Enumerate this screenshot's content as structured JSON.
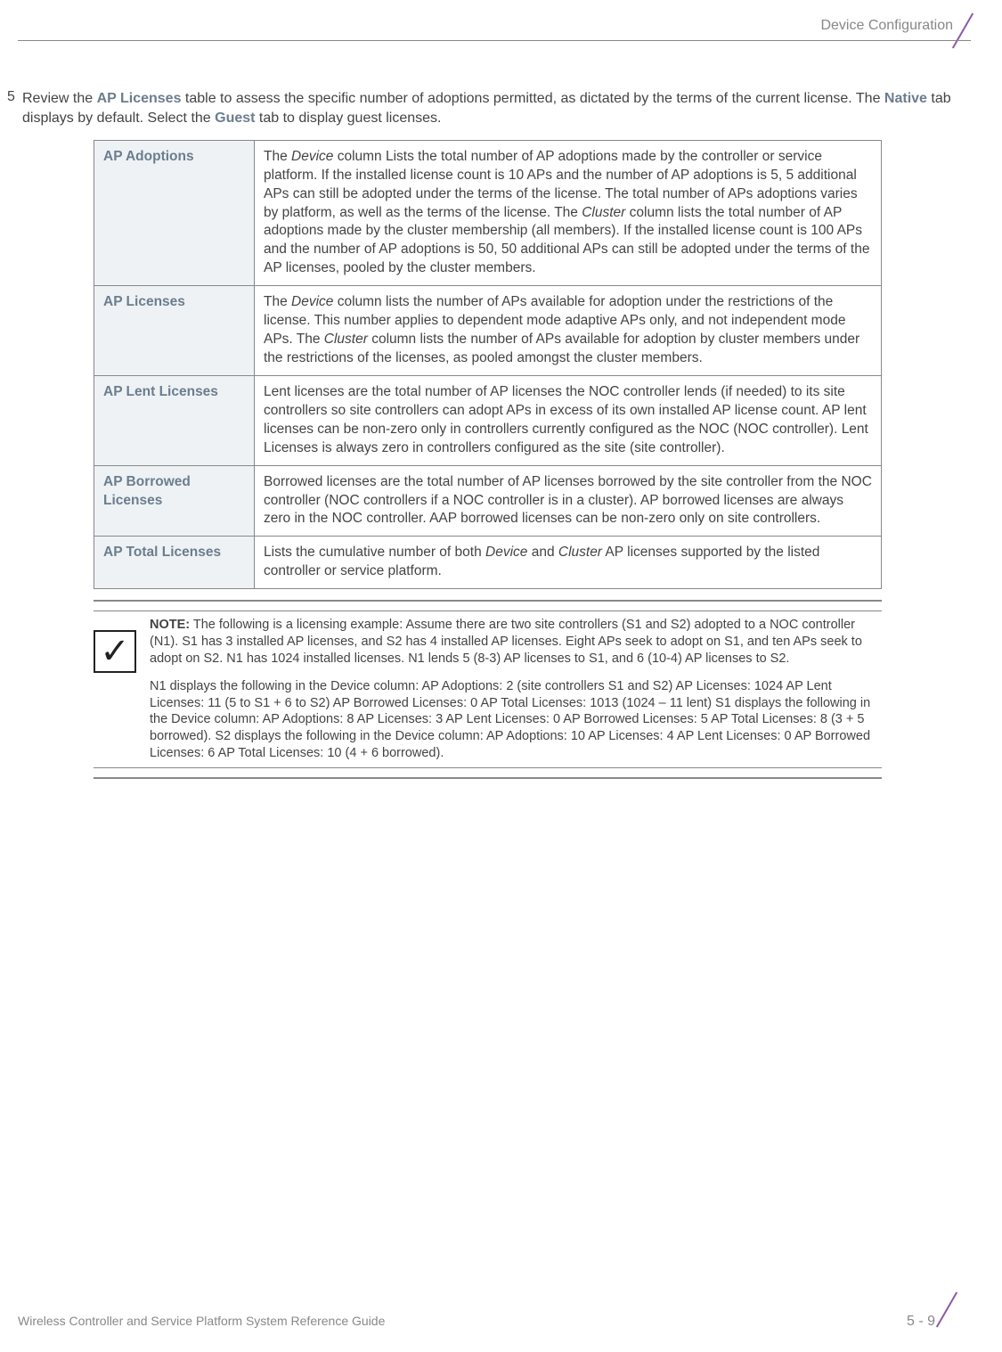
{
  "header": {
    "right_text": "Device Configuration"
  },
  "step": {
    "number": "5",
    "intro_part1": "Review the ",
    "highlight1": "AP Licenses",
    "intro_part2": " table to assess the specific number of adoptions permitted, as dictated by the terms of the current license. The ",
    "highlight2": "Native",
    "intro_part3": " tab displays by default. Select the ",
    "highlight3": "Guest",
    "intro_part4": " tab to display guest licenses."
  },
  "table": {
    "rows": [
      {
        "label": "AP Adoptions",
        "desc_pre": "The ",
        "desc_italic1": "Device",
        "desc_mid": " column Lists the total number of AP adoptions made by the controller or service platform. If the installed license count is 10 APs and the number of AP adoptions is 5, 5 additional APs can still be adopted under the terms of the license. The total number of APs adoptions varies by platform, as well as the terms of the license. The ",
        "desc_italic2": "Cluster",
        "desc_end": " column lists the total number of AP adoptions made by the cluster membership (all members). If the installed license count is 100 APs and the number of AP adoptions is 50, 50 additional APs can still be adopted under the terms of the AP licenses, pooled by the cluster members."
      },
      {
        "label": "AP Licenses",
        "desc_pre": "The ",
        "desc_italic1": "Device",
        "desc_mid": " column lists the number of APs available for adoption under the restrictions of the license. This number applies to dependent mode adaptive APs only, and not independent mode APs. The ",
        "desc_italic2": "Cluster",
        "desc_end": " column lists the number of APs available for adoption by cluster members under the restrictions of the licenses, as pooled amongst the cluster members."
      },
      {
        "label": "AP Lent Licenses",
        "desc_full": "Lent licenses are the total number of AP licenses the NOC controller lends (if needed) to its site controllers so site controllers can adopt APs in excess of its own installed AP license count. AP lent licenses can be non-zero only in controllers currently configured as the NOC (NOC controller). Lent Licenses is always zero in controllers configured as the site (site controller)."
      },
      {
        "label": "AP Borrowed Licenses",
        "desc_full": "Borrowed licenses are the total number of AP licenses borrowed by the site controller from the NOC controller (NOC controllers if a NOC controller is in a cluster). AP borrowed licenses are always zero in the NOC controller. AAP borrowed licenses can be non-zero only on site controllers."
      },
      {
        "label": "AP Total Licenses",
        "desc_pre": "Lists the cumulative number of both ",
        "desc_italic1": "Device",
        "desc_mid": " and ",
        "desc_italic2": "Cluster",
        "desc_end": " AP licenses supported by the listed controller or service platform."
      }
    ]
  },
  "note": {
    "label": "NOTE:",
    "para1": "  The following is a licensing example: Assume there are two site controllers (S1 and S2) adopted to a NOC controller (N1). S1 has 3 installed AP licenses, and S2 has 4 installed AP licenses. Eight APs seek to adopt on S1, and ten APs seek to adopt on S2. N1 has 1024 installed licenses. N1 lends 5 (8-3) AP licenses to S1, and 6 (10-4) AP licenses to S2.",
    "para2": "N1 displays the following in the Device column: AP Adoptions: 2 (site controllers S1 and S2) AP Licenses: 1024 AP Lent Licenses: 11 (5 to S1 + 6 to S2) AP Borrowed Licenses: 0 AP Total Licenses: 1013 (1024 – 11 lent) S1 displays the following in the Device column: AP Adoptions: 8 AP Licenses: 3 AP Lent Licenses: 0 AP Borrowed Licenses: 5 AP Total Licenses: 8 (3 + 5 borrowed). S2 displays the following in the Device column: AP Adoptions: 10 AP Licenses: 4 AP Lent Licenses: 0 AP Borrowed Licenses: 6 AP Total Licenses: 10 (4 + 6 borrowed)."
  },
  "footer": {
    "text": "Wireless Controller and Service Platform System Reference Guide",
    "pagenum": "5 - 9"
  }
}
